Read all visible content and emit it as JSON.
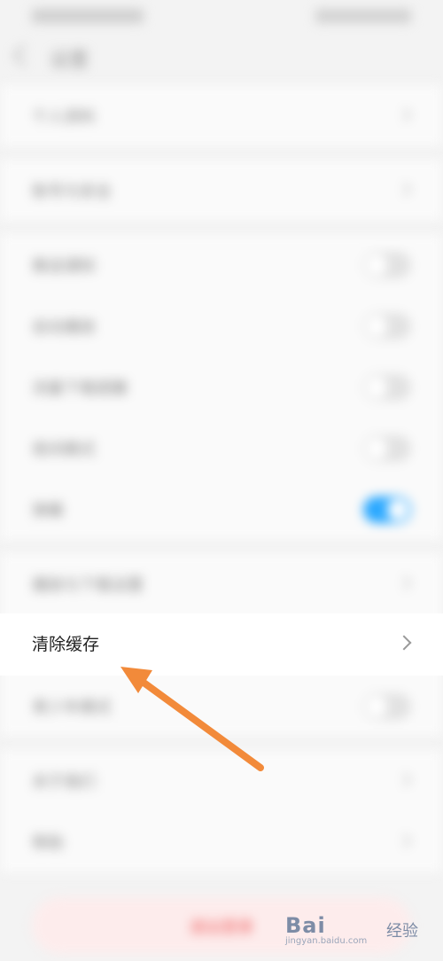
{
  "navbar": {
    "title": "设置"
  },
  "groups": {
    "g1": {
      "items": [
        {
          "label": "个人资料"
        }
      ]
    },
    "g2": {
      "items": [
        {
          "label": "账号与安全"
        }
      ]
    },
    "g3": {
      "items": [
        {
          "label": "推送通知",
          "toggle": "off"
        },
        {
          "label": "自动播放",
          "toggle": "off"
        },
        {
          "label": "流量下载提醒",
          "toggle": "off"
        },
        {
          "label": "夜间模式",
          "toggle": "off"
        },
        {
          "label": "弹幕",
          "toggle": "on"
        }
      ]
    },
    "g4": {
      "items": [
        {
          "label": "播放与下载设置"
        },
        {
          "label": "清除缓存"
        },
        {
          "label": "青少年模式"
        }
      ]
    },
    "g5": {
      "items": [
        {
          "label": "关于我们"
        },
        {
          "label": "帮助"
        }
      ]
    }
  },
  "logout": {
    "label": "退出登录"
  },
  "watermark": {
    "brand": "Bai",
    "sub": "经验",
    "url": "jingyan.baidu.com"
  },
  "colors": {
    "accent": "#2aa8ff",
    "arrow": "#f28a3a",
    "logout_text": "#ef5a5a"
  }
}
